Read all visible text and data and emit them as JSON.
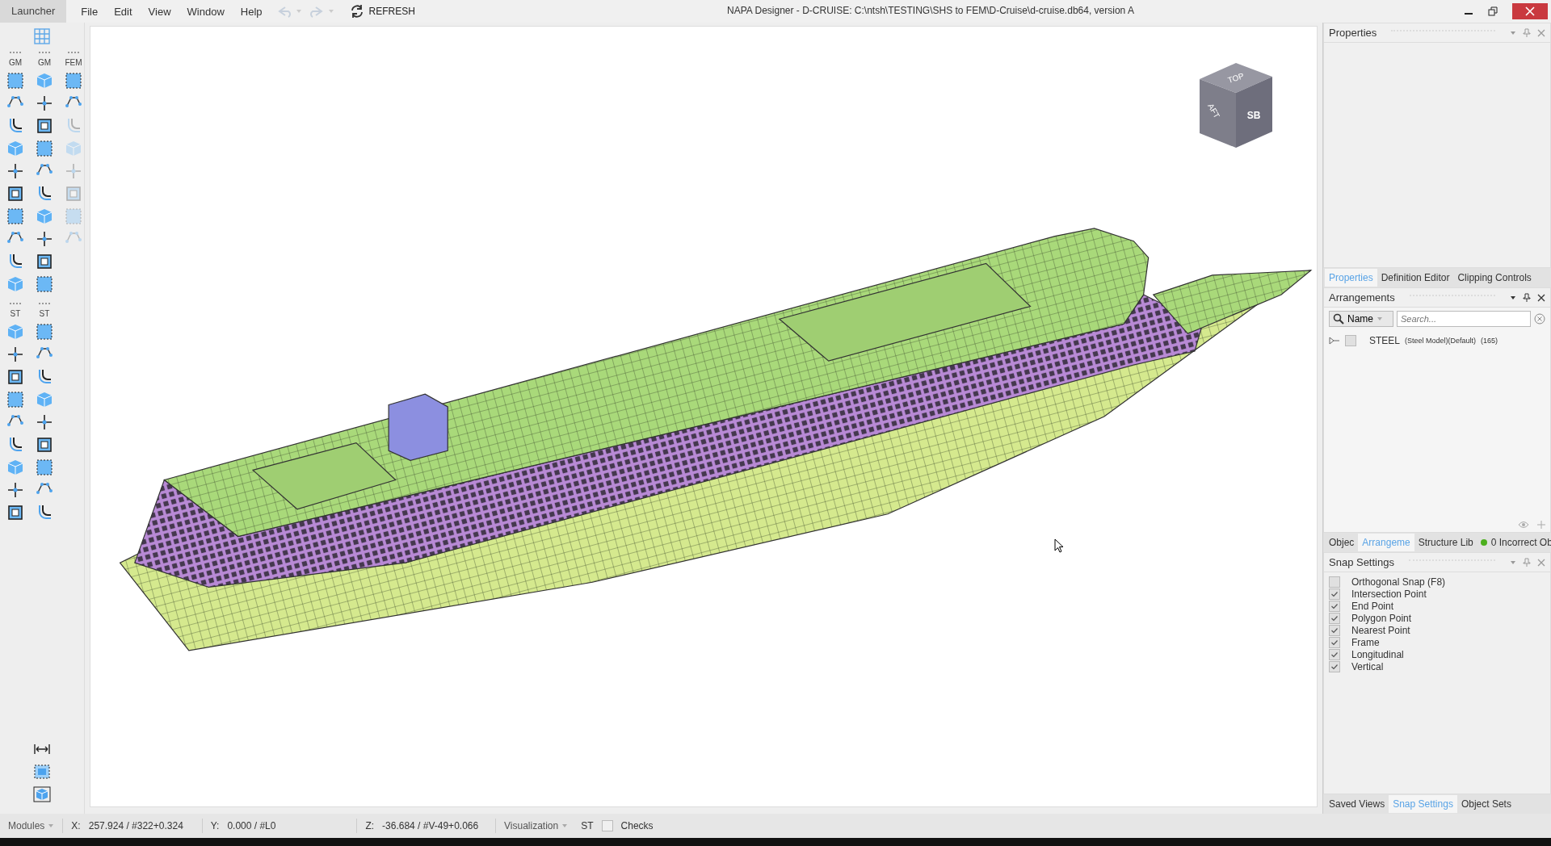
{
  "window": {
    "title": "NAPA Designer - D-CRUISE: C:\\ntsh\\TESTING\\SHS to FEM\\D-Cruise\\d-cruise.db64, version A"
  },
  "menu": {
    "launcher": "Launcher",
    "items": [
      "File",
      "Edit",
      "View",
      "Window",
      "Help"
    ],
    "undo": {
      "disabled": true
    },
    "redo": {
      "disabled": true
    },
    "refresh": "REFRESH"
  },
  "toolbar": {
    "sections": [
      {
        "columns": [
          {
            "header": "GM",
            "tools": [
              {
                "disabled": false
              },
              {
                "disabled": false
              },
              {
                "disabled": false
              },
              {
                "disabled": false
              },
              {
                "disabled": false
              },
              {
                "disabled": false
              },
              {
                "disabled": false
              },
              {
                "disabled": false
              },
              {
                "disabled": false
              },
              {
                "disabled": false
              }
            ]
          },
          {
            "header": "GM",
            "tools": [
              {
                "disabled": false
              },
              {
                "disabled": false
              },
              {
                "disabled": false
              },
              {
                "disabled": false
              },
              {
                "disabled": false
              },
              {
                "disabled": false
              },
              {
                "disabled": false
              },
              {
                "disabled": false
              },
              {
                "disabled": false
              },
              {
                "disabled": false
              }
            ]
          },
          {
            "header": "FEM",
            "tools": [
              {
                "disabled": false
              },
              {
                "disabled": false
              },
              {
                "disabled": true
              },
              {
                "disabled": true
              },
              {
                "disabled": true
              },
              {
                "disabled": true
              },
              {
                "disabled": true
              },
              {
                "disabled": true
              }
            ]
          }
        ]
      },
      {
        "columns": [
          {
            "header": "ST",
            "tools": [
              {
                "disabled": false
              },
              {
                "disabled": false
              },
              {
                "disabled": false
              },
              {
                "disabled": false
              },
              {
                "disabled": false
              },
              {
                "disabled": false
              },
              {
                "disabled": false
              },
              {
                "disabled": false
              },
              {
                "disabled": false
              }
            ]
          },
          {
            "header": "ST",
            "tools": [
              {
                "disabled": false
              },
              {
                "disabled": false
              },
              {
                "disabled": false
              },
              {
                "disabled": false
              },
              {
                "disabled": false
              },
              {
                "disabled": false
              },
              {
                "disabled": false
              },
              {
                "disabled": false
              },
              {
                "disabled": false
              }
            ]
          }
        ]
      }
    ]
  },
  "viewport": {
    "view_cube": {
      "top": "TOP",
      "aft": "AFT",
      "side": "SB"
    }
  },
  "properties_panel": {
    "title": "Properties",
    "tabs": [
      {
        "label": "Properties",
        "selected": true
      },
      {
        "label": "Definition Editor",
        "selected": false
      },
      {
        "label": "Clipping Controls",
        "selected": false
      }
    ]
  },
  "arrangements_panel": {
    "title": "Arrangements",
    "filter": "Name",
    "search": {
      "placeholder": "Search..."
    },
    "tree": [
      {
        "name": "STEEL",
        "detail": "(Steel Model)(Default)",
        "count": "(165)",
        "expanded": false,
        "checked": false
      }
    ],
    "tabs": [
      {
        "label": "Objec",
        "selected": false
      },
      {
        "label": "Arrangeme",
        "selected": true
      },
      {
        "label": "Structure Lib",
        "selected": false
      }
    ],
    "status": {
      "label": "0 Incorrect Ob",
      "color": "#4caf1e"
    }
  },
  "snap_panel": {
    "title": "Snap Settings",
    "items": [
      {
        "label": "Orthogonal Snap (F8)",
        "checked": false
      },
      {
        "label": "Intersection Point",
        "checked": true
      },
      {
        "label": "End Point",
        "checked": true
      },
      {
        "label": "Polygon Point",
        "checked": true
      },
      {
        "label": "Nearest Point",
        "checked": true
      },
      {
        "label": "Frame",
        "checked": true
      },
      {
        "label": "Longitudinal",
        "checked": true
      },
      {
        "label": "Vertical",
        "checked": true
      }
    ],
    "tabs": [
      {
        "label": "Saved Views",
        "selected": false
      },
      {
        "label": "Snap Settings",
        "selected": true
      },
      {
        "label": "Object Sets",
        "selected": false
      }
    ]
  },
  "status_bar": {
    "modules": "Modules",
    "x": {
      "label": "X:",
      "value": "257.924 / #322+0.324"
    },
    "y": {
      "label": "Y:",
      "value": "0.000 / #L0"
    },
    "z": {
      "label": "Z:",
      "value": "-36.684 / #V-49+0.066"
    },
    "visualization": "Visualization",
    "st": "ST",
    "checks": {
      "label": "Checks",
      "checked": false
    }
  }
}
